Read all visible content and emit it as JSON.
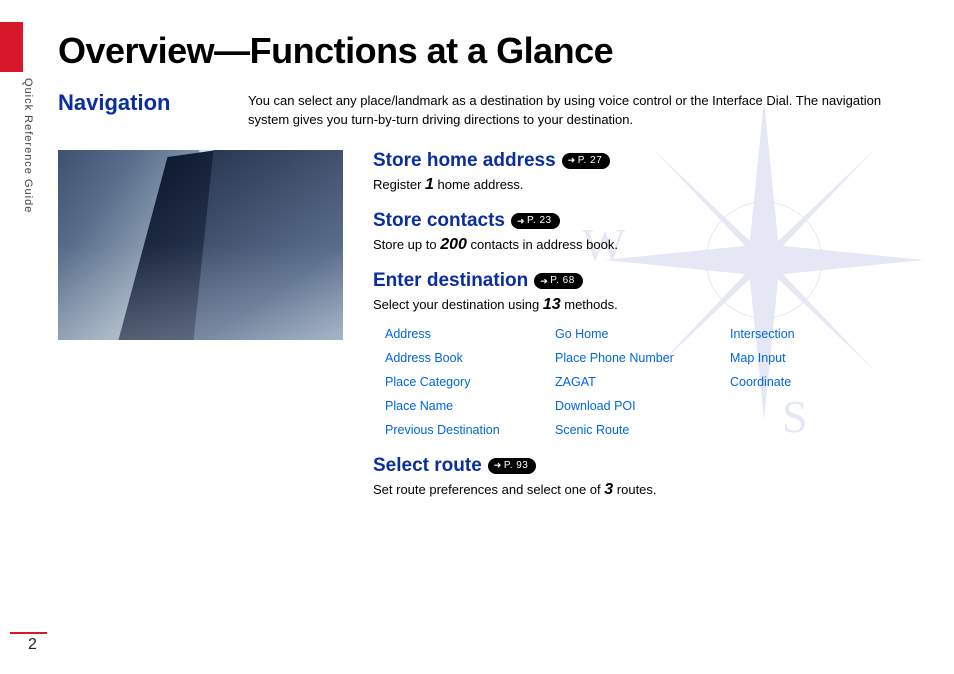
{
  "sidebar": {
    "label": "Quick Reference Guide"
  },
  "page_number": "2",
  "title": "Overview—Functions at a Glance",
  "section": {
    "name": "Navigation",
    "description": "You can select any place/landmark as a destination by using voice control or the Interface Dial. The navigation system gives you turn-by-turn driving directions to your destination."
  },
  "functions": {
    "store_home": {
      "heading": "Store home address",
      "page_ref": "P. 27",
      "desc_pre": "Register ",
      "desc_num": "1",
      "desc_post": " home address."
    },
    "store_contacts": {
      "heading": "Store contacts",
      "page_ref": "P. 23",
      "desc_pre": "Store up to ",
      "desc_num": "200",
      "desc_post": " contacts in address book."
    },
    "enter_destination": {
      "heading": "Enter destination",
      "page_ref": "P. 68",
      "desc_pre": "Select your destination using ",
      "desc_num": "13",
      "desc_post": " methods.",
      "methods": [
        "Address",
        "Go Home",
        "Intersection",
        "Address Book",
        "Place Phone Number",
        "Map Input",
        "Place Category",
        "ZAGAT",
        "Coordinate",
        "Place Name",
        "Download POI",
        "",
        "Previous Destination",
        "Scenic Route",
        ""
      ]
    },
    "select_route": {
      "heading": "Select route",
      "page_ref": "P. 93",
      "desc_pre": "Set route preferences and select one of ",
      "desc_num": "3",
      "desc_post": " routes."
    }
  },
  "compass": {
    "west": "W",
    "south": "S"
  }
}
